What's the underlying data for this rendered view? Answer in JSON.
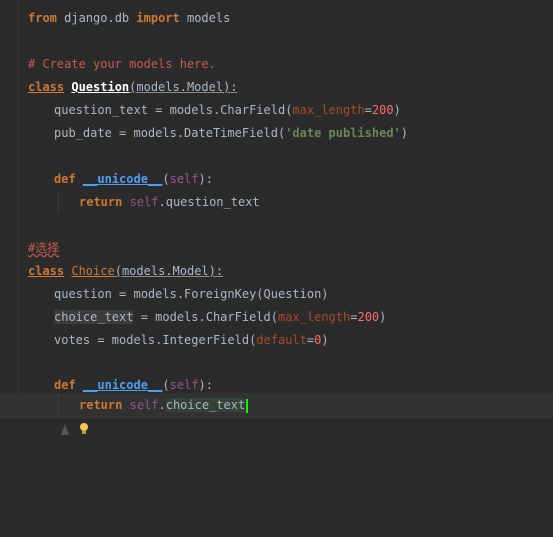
{
  "editor": {
    "lines": {
      "l1": {
        "kw_from": "from",
        "mod": " django.db ",
        "kw_import": "import",
        "name": " models"
      },
      "l2": {
        "comment": "# Create your models here."
      },
      "l3": {
        "kw_class": "class",
        "sp": " ",
        "cls": "Question",
        "base": "(models.Model):"
      },
      "l4": {
        "name": "question_text = models.CharField(",
        "param": "max_length",
        "eq": "=",
        "num": "200",
        "close": ")"
      },
      "l5": {
        "name": "pub_date = models.DateTimeField(",
        "str": "'date published'",
        "close": ")"
      },
      "l6": {
        "kw_def": "def",
        "sp": " ",
        "fn": "__unicode__",
        "open": "(",
        "self": "self",
        "close": "):"
      },
      "l7": {
        "kw_return": "return",
        "sp": " ",
        "self": "self",
        "rest": ".question_text"
      },
      "l8": {
        "comment": "#选择"
      },
      "l9": {
        "kw_class": "class",
        "sp": " ",
        "cls": "Choice",
        "base": "(models.Model):"
      },
      "l10": {
        "name": "question = models.ForeignKey(Question)"
      },
      "l11": {
        "name_a": "choice_text",
        "name_b": " = models.CharField(",
        "param": "max_length",
        "eq": "=",
        "num": "200",
        "close": ")"
      },
      "l12": {
        "name": "votes = models.IntegerField(",
        "param": "default",
        "eq": "=",
        "num": "0",
        "close": ")"
      },
      "l13": {
        "kw_def": "def",
        "sp": " ",
        "fn": "__unicode__",
        "open": "(",
        "self": "self",
        "close": "):"
      },
      "l14": {
        "kw_return": "return",
        "sp": " ",
        "self": "self",
        "dot": ".",
        "rest": "choice_text"
      }
    },
    "gutter_icons": [
      "breakpoint-icon",
      "lightbulb-icon"
    ]
  }
}
